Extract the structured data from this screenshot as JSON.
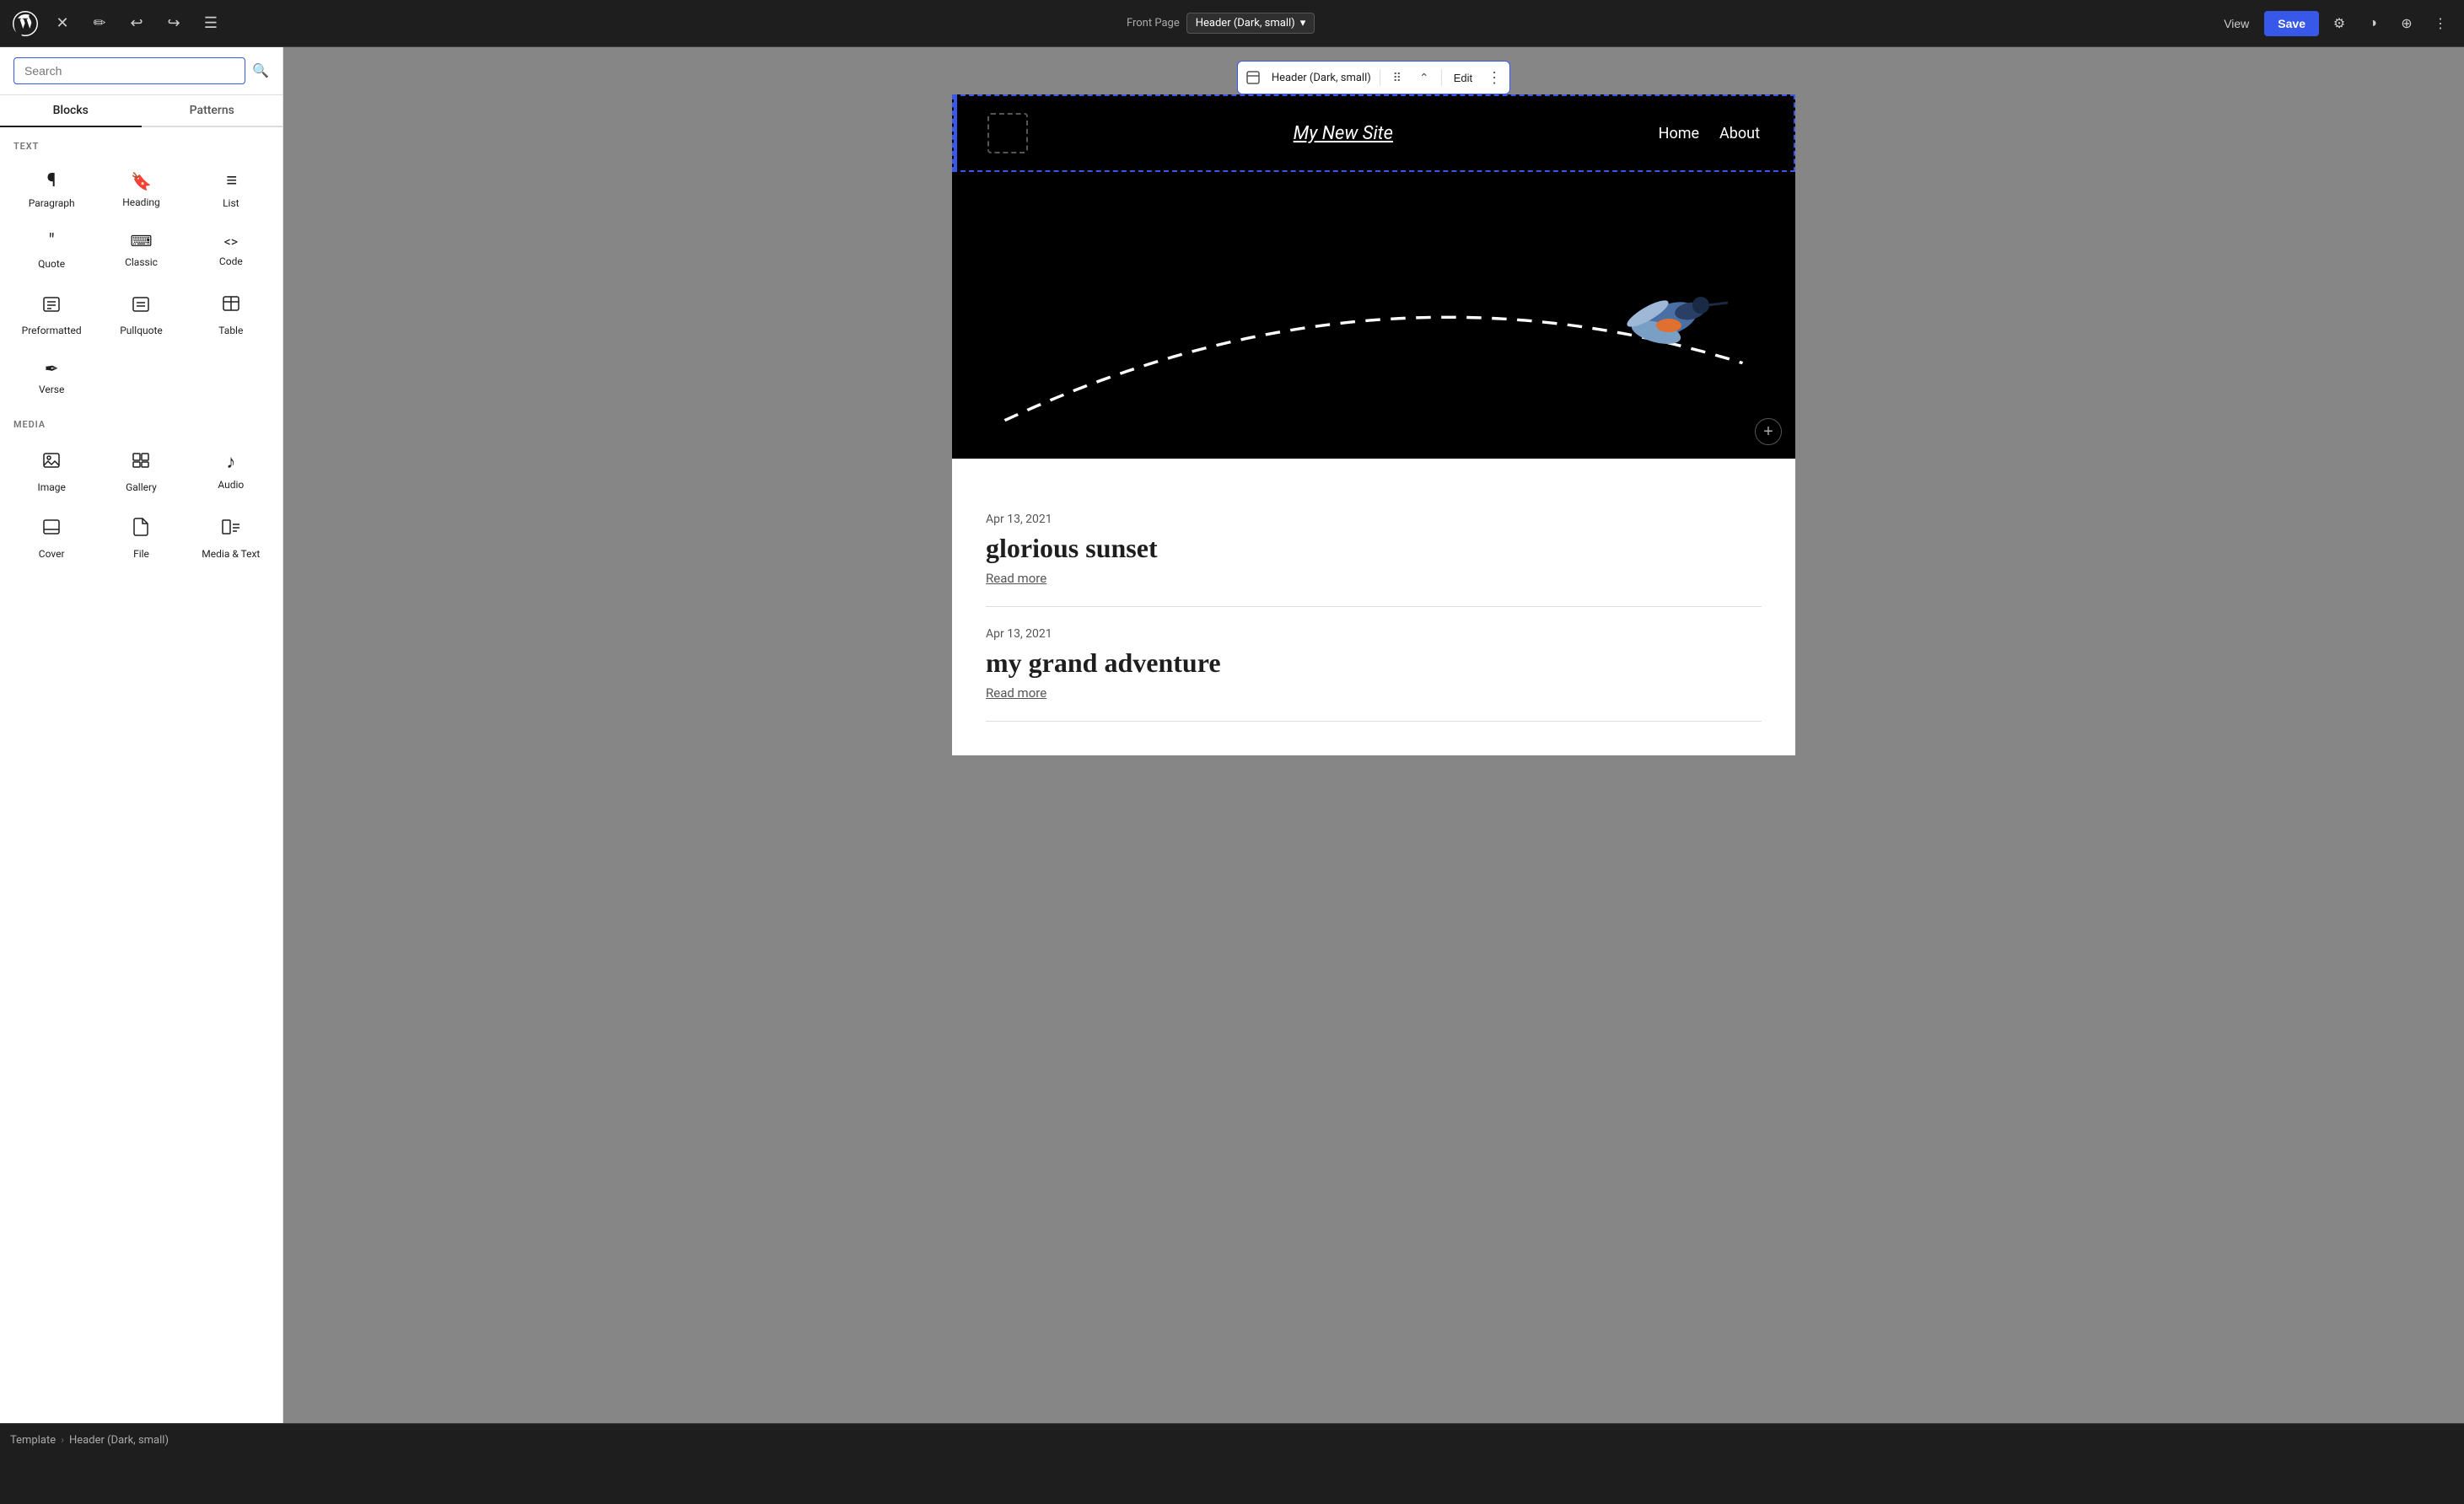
{
  "toolbar": {
    "front_page_label": "Front Page",
    "template_badge": "Header (Dark, small)",
    "view_label": "View",
    "save_label": "Save"
  },
  "sidebar": {
    "search_placeholder": "Search",
    "tabs": [
      {
        "id": "blocks",
        "label": "Blocks"
      },
      {
        "id": "patterns",
        "label": "Patterns"
      }
    ],
    "active_tab": "blocks",
    "sections": [
      {
        "id": "text",
        "label": "TEXT",
        "blocks": [
          {
            "id": "paragraph",
            "icon": "¶",
            "label": "Paragraph"
          },
          {
            "id": "heading",
            "icon": "🔖",
            "label": "Heading"
          },
          {
            "id": "list",
            "icon": "≡",
            "label": "List"
          },
          {
            "id": "quote",
            "icon": "❝",
            "label": "Quote"
          },
          {
            "id": "classic",
            "icon": "⌨",
            "label": "Classic"
          },
          {
            "id": "code",
            "icon": "<>",
            "label": "Code"
          },
          {
            "id": "preformatted",
            "icon": "⊡",
            "label": "Preformatted"
          },
          {
            "id": "pullquote",
            "icon": "⊟",
            "label": "Pullquote"
          },
          {
            "id": "table",
            "icon": "⊞",
            "label": "Table"
          },
          {
            "id": "verse",
            "icon": "✒",
            "label": "Verse"
          }
        ]
      },
      {
        "id": "media",
        "label": "MEDIA",
        "blocks": [
          {
            "id": "image",
            "icon": "🖼",
            "label": "Image"
          },
          {
            "id": "gallery",
            "icon": "⊟",
            "label": "Gallery"
          },
          {
            "id": "audio",
            "icon": "♪",
            "label": "Audio"
          },
          {
            "id": "cover",
            "icon": "⊡",
            "label": "Cover"
          },
          {
            "id": "file",
            "icon": "📁",
            "label": "File"
          },
          {
            "id": "media-text",
            "icon": "⊞",
            "label": "Media & Text"
          }
        ]
      }
    ]
  },
  "template_part_toolbar": {
    "label": "Header (Dark, small)",
    "edit_label": "Edit",
    "more_label": "⋮"
  },
  "site": {
    "title": "My New Site",
    "nav": [
      {
        "label": "Home"
      },
      {
        "label": "About"
      }
    ],
    "posts": [
      {
        "date": "Apr 13, 2021",
        "title": "glorious sunset",
        "read_more": "Read more"
      },
      {
        "date": "Apr 13, 2021",
        "title": "my grand adventure",
        "read_more": "Read more"
      }
    ]
  },
  "bottom_bar": {
    "breadcrumb_template": "Template",
    "breadcrumb_sep": "›",
    "breadcrumb_part": "Header (Dark, small)"
  }
}
